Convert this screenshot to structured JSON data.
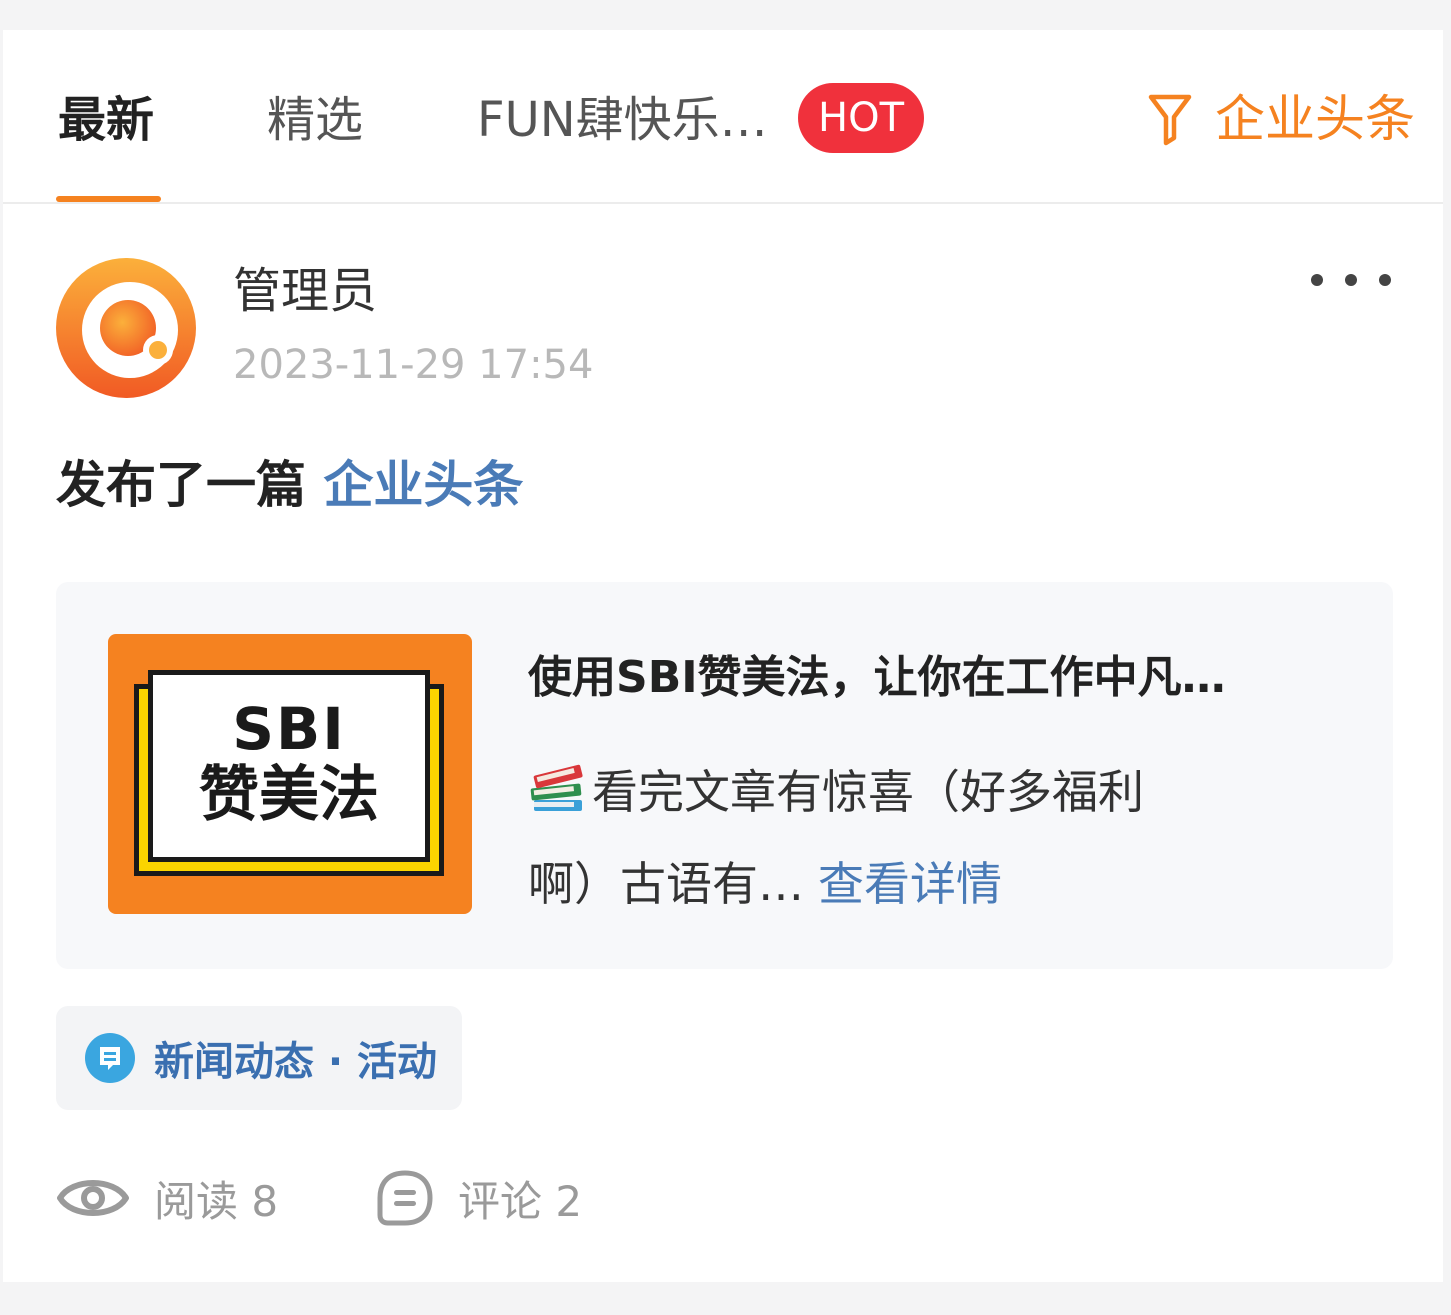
{
  "tabs": [
    {
      "label": "最新",
      "active": true
    },
    {
      "label": "精选",
      "active": false
    },
    {
      "label": "FUN肆快乐…",
      "active": false
    }
  ],
  "hot_badge": "HOT",
  "filter": {
    "label": "企业头条",
    "icon": "filter-icon",
    "color": "#f58220"
  },
  "post": {
    "author": "管理员",
    "time": "2023-11-29 17:54",
    "publish_prefix": "发布了一篇",
    "publish_link": "企业头条",
    "article": {
      "thumb_line1": "SBI",
      "thumb_line2": "赞美法",
      "title": "使用SBI赞美法，让你在工作中凡…",
      "summary_line1": "看完文章有惊喜（好多福利",
      "summary_line2": "啊）古语有…",
      "detail_link": "查看详情"
    },
    "category": "新闻动态 · 活动",
    "reads": "阅读 8",
    "comments": "评论 2"
  },
  "colors": {
    "accent": "#f58220",
    "hot": "#f0313c",
    "link": "#4a7bb7"
  }
}
